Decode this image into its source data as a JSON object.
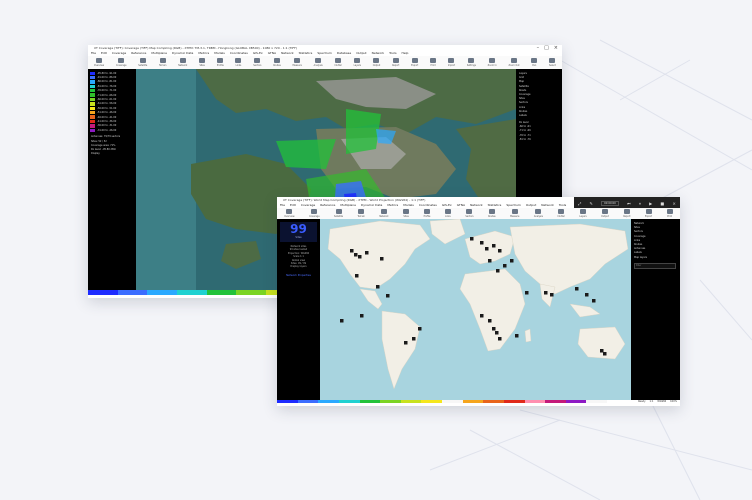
{
  "window1": {
    "title": "XT Coverage (TIFF): Coverage (TIFF) Map Compiling (RGB) - XTPM: TM-3.1, TRBM - Hongkong (GLOBAL XB500) - 1080 x 720 - 1:1 (TIFF)",
    "menu": [
      "File",
      "Edit",
      "Coverage",
      "Reference",
      "Multiplane",
      "Dynamic Data",
      "Metrics",
      "Models",
      "Coordinates",
      "GIS-Ex",
      "GTNA",
      "Network",
      "Statistics",
      "Spectrum",
      "Database",
      "Output",
      "Network",
      "Tools",
      "Help"
    ],
    "toolbar": [
      "Overview",
      "Coverage",
      "Satellite",
      "Terrain",
      "Network",
      "Sites",
      "Profile",
      "Links",
      "Sectors",
      "Routes",
      "Measure",
      "Analysis",
      "Clutter",
      "Layers",
      "Output",
      "Report",
      "Export",
      "Print",
      "Import",
      "Settings",
      "Zoom In",
      "Zoom Out",
      "Pan",
      "Select"
    ],
    "legend": [
      {
        "label": "-95.80 to -91.00",
        "color": "#1e2cff"
      },
      {
        "label": "-91.00 to -86.00",
        "color": "#3b6dff"
      },
      {
        "label": "-86.00 to -81.00",
        "color": "#2aa9ff"
      },
      {
        "label": "-81.00 to -76.00",
        "color": "#1fd1d1"
      },
      {
        "label": "-76.00 to -71.00",
        "color": "#22c23a"
      },
      {
        "label": "-71.00 to -66.00",
        "color": "#2fbf2a"
      },
      {
        "label": "-66.00 to -61.00",
        "color": "#7bd424"
      },
      {
        "label": "-61.00 to -56.00",
        "color": "#c8e21e"
      },
      {
        "label": "-56.00 to -51.00",
        "color": "#f5e71d"
      },
      {
        "label": "-51.00 to -46.00",
        "color": "#f5a51d"
      },
      {
        "label": "-46.00 to -41.00",
        "color": "#e8651b"
      },
      {
        "label": "-41.00 to -36.00",
        "color": "#e02a1a"
      },
      {
        "label": "-36.00 to -31.00",
        "color": "#c41a7a"
      },
      {
        "label": "-31.00 to -26.00",
        "color": "#8d1ac4"
      }
    ],
    "panel_notes": [
      "Antennas: 79/79 sectors",
      "Sites: 52 / 52",
      "Coverage area: 71%",
      "Rx level: -95.80 dBm",
      "Display"
    ],
    "right_items": [
      "Layers",
      "Grid",
      "Map",
      "Satellite",
      "Roads",
      "Coverage",
      "Sites",
      "Sectors",
      "Links",
      "Routes",
      "Labels"
    ],
    "right_sub": [
      "Rx level",
      "-66 to -61",
      "-71 to -66",
      "-76 to -71",
      "-81 to -76"
    ],
    "palette": [
      "#1e2cff",
      "#3b6dff",
      "#2aa9ff",
      "#1fd1d1",
      "#22c23a",
      "#7bd424",
      "#c8e21e",
      "#f5e71d",
      "#f7f7f7",
      "#f5a51d",
      "#e8651b",
      "#e02a1a",
      "#ff8fb0",
      "#c41a7a",
      "#8d1ac4",
      "#f7f7f7"
    ]
  },
  "window2": {
    "title": "XT Coverage (TIFF): World Map Compiling (RGB) - XTPM - World Projection (WGS84) - 1:1 (TIFF)",
    "menu": [
      "File",
      "Edit",
      "Coverage",
      "Reference",
      "Multiplane",
      "Dynamic Data",
      "Metrics",
      "Models",
      "Coordinates",
      "GIS-Ex",
      "GTNA",
      "Network",
      "Statistics",
      "Spectrum",
      "Output",
      "Network",
      "Tools",
      "Help"
    ],
    "toolbar": [
      "Overview",
      "Coverage",
      "Satellite",
      "Terrain",
      "Network",
      "Sites",
      "Profile",
      "Links",
      "Sectors",
      "Routes",
      "Measure",
      "Analysis",
      "Clutter",
      "Layers",
      "Output",
      "Report",
      "Export",
      "Print"
    ],
    "counter": "99",
    "counter_label": "Sites",
    "info_lines": [
      "Network sites",
      "99 sites loaded",
      "Projection: WGS84",
      "Scale 1:1",
      "Global view",
      "Sites: 99 / 99",
      "Display layers"
    ],
    "link_text": "Network Properties",
    "top_controls": [
      "Zoom",
      "Play",
      "Pause",
      "Stop",
      "Record",
      "Close"
    ],
    "time_display": "00:00:00",
    "right_items": [
      "Network",
      "Sites",
      "Sectors",
      "Coverage",
      "Links",
      "Routes",
      "Antennas",
      "Labels",
      "Map layers"
    ],
    "filter_placeholder": "Filter",
    "status_items": [
      "Ready",
      "1:1",
      "WGS84",
      "100%"
    ]
  }
}
